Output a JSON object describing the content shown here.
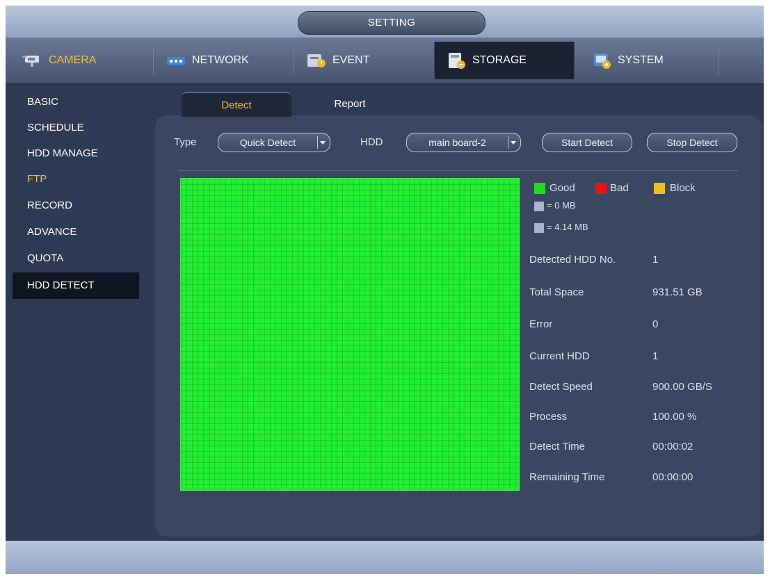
{
  "title": "SETTING",
  "main_tabs": [
    {
      "label": "CAMERA",
      "icon": "camera-icon"
    },
    {
      "label": "NETWORK",
      "icon": "network-icon"
    },
    {
      "label": "EVENT",
      "icon": "event-icon"
    },
    {
      "label": "STORAGE",
      "icon": "storage-icon"
    },
    {
      "label": "SYSTEM",
      "icon": "system-icon"
    }
  ],
  "sidebar": {
    "items": [
      {
        "label": "BASIC"
      },
      {
        "label": "SCHEDULE"
      },
      {
        "label": "HDD MANAGE"
      },
      {
        "label": "FTP"
      },
      {
        "label": "RECORD"
      },
      {
        "label": "ADVANCE"
      },
      {
        "label": "QUOTA"
      },
      {
        "label": "HDD DETECT"
      }
    ]
  },
  "sub_tabs": [
    {
      "label": "Detect"
    },
    {
      "label": "Report"
    }
  ],
  "controls": {
    "type_label": "Type",
    "type_value": "Quick Detect",
    "hdd_label": "HDD",
    "hdd_value": "main board-2",
    "start_button": "Start Detect",
    "stop_button": "Stop Detect"
  },
  "legend": {
    "good": "Good",
    "bad": "Bad",
    "block": "Block",
    "size_zero": "= 0 MB",
    "size_block": "= 4.14 MB",
    "colors": {
      "good": "#22dd22",
      "bad": "#ee1111",
      "block": "#f0c020",
      "size": "#a9b4cf"
    }
  },
  "info": [
    {
      "label": "Detected HDD No.",
      "value": "1"
    },
    {
      "label": "Total Space",
      "value": "931.51 GB"
    },
    {
      "label": "Error",
      "value": "0"
    },
    {
      "label": "Current HDD",
      "value": "1"
    },
    {
      "label": "Detect Speed",
      "value": "900.00 GB/S"
    },
    {
      "label": "Process",
      "value": "100.00 %"
    },
    {
      "label": "Detect Time",
      "value": "00:00:02"
    },
    {
      "label": "Remaining Time",
      "value": "00:00:00"
    }
  ],
  "detect_grid_color": "#22ee33"
}
